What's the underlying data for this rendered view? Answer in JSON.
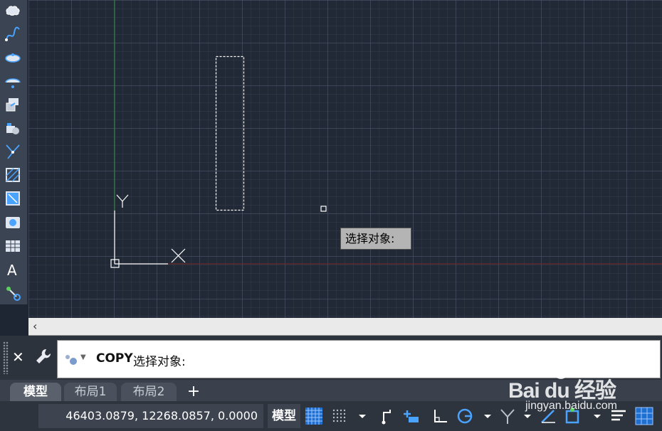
{
  "canvas": {
    "tooltip_text": "选择对象:",
    "ucs_labels": {
      "y": "Y",
      "x": "X"
    }
  },
  "command_line": {
    "keyword": "COPY",
    "prompt": "选择对象:"
  },
  "tabs": [
    {
      "label": "模型",
      "active": true
    },
    {
      "label": "布局1",
      "active": false
    },
    {
      "label": "布局2",
      "active": false
    }
  ],
  "tab_add_label": "+",
  "status_bar": {
    "coordinates": "46403.0879, 12268.0857, 0.0000",
    "model_label": "模型"
  },
  "watermark": {
    "brand": "Bai du 经验",
    "url": "jingyan.baidu.com"
  },
  "left_toolbar_icons": [
    "revision-cloud-icon",
    "spline-icon",
    "ellipse-icon",
    "ellipse-arc-icon",
    "insert-block-icon",
    "make-block-icon",
    "point-icon",
    "hatch-icon",
    "gradient-icon",
    "region-icon",
    "table-icon",
    "multiline-text-icon",
    "add-selected-icon"
  ],
  "colors": {
    "canvas_background": "#222936",
    "y_axis": "#2e8b3a",
    "x_axis": "#8b2f2f",
    "command_background": "#ffffff",
    "accent_blue": "#1e90ff"
  }
}
